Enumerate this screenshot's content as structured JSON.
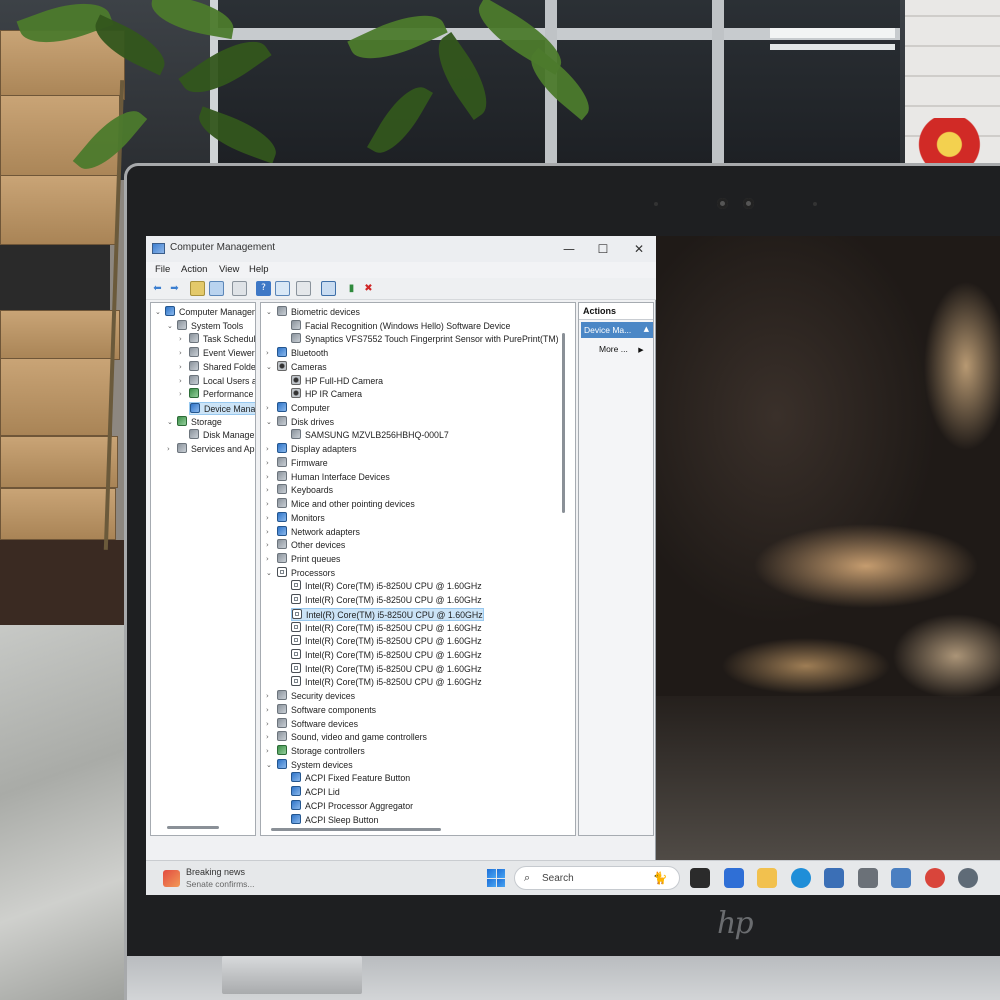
{
  "window": {
    "title": "Computer Management",
    "minimize": "—",
    "maximize": "☐",
    "close": "✕"
  },
  "menu": [
    "File",
    "Action",
    "View",
    "Help"
  ],
  "left_tree": [
    {
      "label": "Computer Managem",
      "indent": 0,
      "arrow": "⌄",
      "icon": "computer-management-icon"
    },
    {
      "label": "System Tools",
      "indent": 1,
      "arrow": "⌄",
      "icon": "system-tools-icon"
    },
    {
      "label": "Task Schedule",
      "indent": 2,
      "arrow": "›",
      "icon": "task-scheduler-icon"
    },
    {
      "label": "Event Viewer",
      "indent": 2,
      "arrow": "›",
      "icon": "event-viewer-icon"
    },
    {
      "label": "Shared Folde",
      "indent": 2,
      "arrow": "›",
      "icon": "shared-folders-icon"
    },
    {
      "label": "Local Users an",
      "indent": 2,
      "arrow": "›",
      "icon": "local-users-icon"
    },
    {
      "label": "Performance",
      "indent": 2,
      "arrow": "›",
      "icon": "performance-icon"
    },
    {
      "label": "Device Manag",
      "indent": 2,
      "arrow": "",
      "icon": "device-manager-icon",
      "selected": true
    },
    {
      "label": "Storage",
      "indent": 1,
      "arrow": "⌄",
      "icon": "storage-icon"
    },
    {
      "label": "Disk Manager",
      "indent": 2,
      "arrow": "",
      "icon": "disk-management-icon"
    },
    {
      "label": "Services and App",
      "indent": 1,
      "arrow": "›",
      "icon": "services-icon"
    }
  ],
  "device_tree": [
    {
      "label": "Biometric devices",
      "level": 0,
      "arrow": "⌄",
      "icon": "biometric-icon"
    },
    {
      "label": "Facial Recognition (Windows Hello) Software Device",
      "level": 1,
      "icon": "biometric-device-icon"
    },
    {
      "label": "Synaptics VFS7552 Touch Fingerprint Sensor with PurePrint(TM)",
      "level": 1,
      "icon": "fingerprint-icon"
    },
    {
      "label": "Bluetooth",
      "level": 0,
      "arrow": "›",
      "icon": "bluetooth-icon"
    },
    {
      "label": "Cameras",
      "level": 0,
      "arrow": "⌄",
      "icon": "camera-icon"
    },
    {
      "label": "HP Full-HD Camera",
      "level": 1,
      "icon": "camera-icon"
    },
    {
      "label": "HP IR Camera",
      "level": 1,
      "icon": "camera-icon"
    },
    {
      "label": "Computer",
      "level": 0,
      "arrow": "›",
      "icon": "computer-icon"
    },
    {
      "label": "Disk drives",
      "level": 0,
      "arrow": "⌄",
      "icon": "disk-drive-icon"
    },
    {
      "label": "SAMSUNG MZVLB256HBHQ-000L7",
      "level": 1,
      "icon": "disk-drive-icon"
    },
    {
      "label": "Display adapters",
      "level": 0,
      "arrow": "›",
      "icon": "display-adapter-icon"
    },
    {
      "label": "Firmware",
      "level": 0,
      "arrow": "›",
      "icon": "firmware-icon"
    },
    {
      "label": "Human Interface Devices",
      "level": 0,
      "arrow": "›",
      "icon": "hid-icon"
    },
    {
      "label": "Keyboards",
      "level": 0,
      "arrow": "›",
      "icon": "keyboard-icon"
    },
    {
      "label": "Mice and other pointing devices",
      "level": 0,
      "arrow": "›",
      "icon": "mouse-icon"
    },
    {
      "label": "Monitors",
      "level": 0,
      "arrow": "›",
      "icon": "monitor-icon"
    },
    {
      "label": "Network adapters",
      "level": 0,
      "arrow": "›",
      "icon": "network-adapter-icon"
    },
    {
      "label": "Other devices",
      "level": 0,
      "arrow": "›",
      "icon": "other-devices-icon"
    },
    {
      "label": "Print queues",
      "level": 0,
      "arrow": "›",
      "icon": "printer-icon"
    },
    {
      "label": "Processors",
      "level": 0,
      "arrow": "⌄",
      "icon": "processor-icon"
    },
    {
      "label": "Intel(R) Core(TM) i5-8250U CPU @ 1.60GHz",
      "level": 1,
      "icon": "processor-icon"
    },
    {
      "label": "Intel(R) Core(TM) i5-8250U CPU @ 1.60GHz",
      "level": 1,
      "icon": "processor-icon"
    },
    {
      "label": "Intel(R) Core(TM) i5-8250U CPU @ 1.60GHz",
      "level": 1,
      "icon": "processor-icon",
      "selected": true
    },
    {
      "label": "Intel(R) Core(TM) i5-8250U CPU @ 1.60GHz",
      "level": 1,
      "icon": "processor-icon"
    },
    {
      "label": "Intel(R) Core(TM) i5-8250U CPU @ 1.60GHz",
      "level": 1,
      "icon": "processor-icon"
    },
    {
      "label": "Intel(R) Core(TM) i5-8250U CPU @ 1.60GHz",
      "level": 1,
      "icon": "processor-icon"
    },
    {
      "label": "Intel(R) Core(TM) i5-8250U CPU @ 1.60GHz",
      "level": 1,
      "icon": "processor-icon"
    },
    {
      "label": "Intel(R) Core(TM) i5-8250U CPU @ 1.60GHz",
      "level": 1,
      "icon": "processor-icon"
    },
    {
      "label": "Security devices",
      "level": 0,
      "arrow": "›",
      "icon": "security-device-icon"
    },
    {
      "label": "Software components",
      "level": 0,
      "arrow": "›",
      "icon": "software-component-icon"
    },
    {
      "label": "Software devices",
      "level": 0,
      "arrow": "›",
      "icon": "software-device-icon"
    },
    {
      "label": "Sound, video and game controllers",
      "level": 0,
      "arrow": "›",
      "icon": "sound-icon"
    },
    {
      "label": "Storage controllers",
      "level": 0,
      "arrow": "›",
      "icon": "storage-controller-icon"
    },
    {
      "label": "System devices",
      "level": 0,
      "arrow": "⌄",
      "icon": "system-device-icon"
    },
    {
      "label": "ACPI Fixed Feature Button",
      "level": 1,
      "icon": "system-device-icon"
    },
    {
      "label": "ACPI Lid",
      "level": 1,
      "icon": "system-device-icon"
    },
    {
      "label": "ACPI Processor Aggregator",
      "level": 1,
      "icon": "system-device-icon"
    },
    {
      "label": "ACPI Sleep Button",
      "level": 1,
      "icon": "system-device-icon"
    }
  ],
  "actions": {
    "header": "Actions",
    "section": "Device Ma...",
    "section_arrow": "▲",
    "more": "More ...",
    "more_arrow": "▶"
  },
  "taskbar": {
    "news_title": "Breaking news",
    "news_subtitle": "Senate confirms...",
    "search_placeholder": "Search",
    "search_icon": "⌕",
    "search_badge": "🐈",
    "apps": [
      {
        "name": "task-view-icon",
        "color": "#2b2b2b"
      },
      {
        "name": "news-app-icon",
        "color": "#2f6fd6"
      },
      {
        "name": "file-explorer-icon",
        "color": "#f2c14e"
      },
      {
        "name": "edge-icon",
        "color": "#1f8ed8"
      },
      {
        "name": "store-icon",
        "color": "#3b6fb6"
      },
      {
        "name": "settings-icon",
        "color": "#6b7178"
      },
      {
        "name": "computer-management-taskbar-icon",
        "color": "#4a7fc1"
      },
      {
        "name": "chrome-icon",
        "color": "#d9453b"
      },
      {
        "name": "tool-icon",
        "color": "#5f6b77"
      }
    ]
  },
  "laptop": {
    "brand": "hp"
  }
}
